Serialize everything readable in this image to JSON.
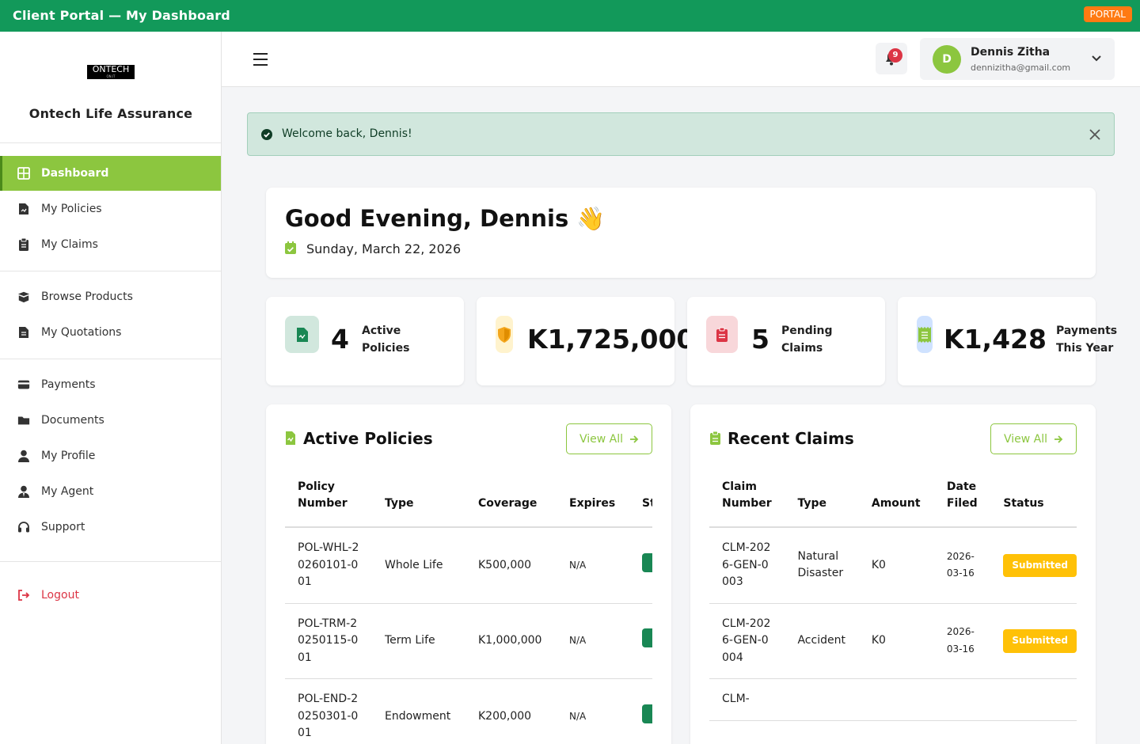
{
  "topbar": {
    "title": "Client Portal — My Dashboard",
    "badge": "PORTAL"
  },
  "sidebar": {
    "logo_text": "ONTECH",
    "logo_sub": "ON.IT",
    "brand": "Ontech Life Assurance",
    "items": [
      {
        "label": "Dashboard",
        "icon": "dashboard-icon"
      },
      {
        "label": "My Policies",
        "icon": "policy-icon"
      },
      {
        "label": "My Claims",
        "icon": "claims-icon"
      },
      {
        "label": "Browse Products",
        "icon": "products-icon"
      },
      {
        "label": "My Quotations",
        "icon": "quotation-icon"
      },
      {
        "label": "Payments",
        "icon": "payments-icon"
      },
      {
        "label": "Documents",
        "icon": "folder-icon"
      },
      {
        "label": "My Profile",
        "icon": "user-icon"
      },
      {
        "label": "My Agent",
        "icon": "agent-icon"
      },
      {
        "label": "Support",
        "icon": "headset-icon"
      },
      {
        "label": "Logout",
        "icon": "logout-icon"
      }
    ]
  },
  "header": {
    "notification_count": "9",
    "user": {
      "initial": "D",
      "name": "Dennis Zitha",
      "email": "dennizitha@gmail.com"
    }
  },
  "alert": {
    "message": "Welcome back, Dennis!"
  },
  "greeting": {
    "title": "Good Evening, Dennis 👋",
    "date": "Sunday, March 22, 2026"
  },
  "stats": [
    {
      "value": "4",
      "label": "Active Policies",
      "icon": "policy-doc-icon",
      "color": "#d1e7dd"
    },
    {
      "value": "K1,725,000",
      "label": "",
      "icon": "shield-icon",
      "color": "#fff3cd"
    },
    {
      "value": "5",
      "label": "Pending Claims",
      "icon": "clipboard-icon",
      "color": "#f8d7da"
    },
    {
      "value": "K1,428",
      "label": "Payments This Year",
      "icon": "receipt-icon",
      "color": "#cfe2ff"
    }
  ],
  "policies": {
    "title": "Active Policies",
    "view_all": "View All",
    "headers": [
      "Policy Number",
      "Type",
      "Coverage",
      "Expires",
      "St"
    ],
    "rows": [
      {
        "number": "POL-WHL-20260101-001",
        "type": "Whole Life",
        "coverage": "K500,000",
        "expires": "N/A"
      },
      {
        "number": "POL-TRM-20250115-001",
        "type": "Term Life",
        "coverage": "K1,000,000",
        "expires": "N/A"
      },
      {
        "number": "POL-END-20250301-001",
        "type": "Endowment",
        "coverage": "K200,000",
        "expires": "N/A"
      }
    ]
  },
  "claims": {
    "title": "Recent Claims",
    "view_all": "View All",
    "headers": [
      "Claim Number",
      "Type",
      "Amount",
      "Date Filed",
      "Status"
    ],
    "rows": [
      {
        "number": "CLM-2026-GEN-0003",
        "type": "Natural Disaster",
        "amount": "K0",
        "date": "2026-03-16",
        "status": "Submitted"
      },
      {
        "number": "CLM-2026-GEN-0004",
        "type": "Accident",
        "amount": "K0",
        "date": "2026-03-16",
        "status": "Submitted"
      },
      {
        "number": "CLM-",
        "type": "",
        "amount": "",
        "date": "",
        "status": ""
      }
    ]
  },
  "colors": {
    "topbar": "#12995a",
    "accent": "#8cc63f",
    "danger": "#dc3545",
    "warning": "#ffc107",
    "success": "#198754"
  }
}
